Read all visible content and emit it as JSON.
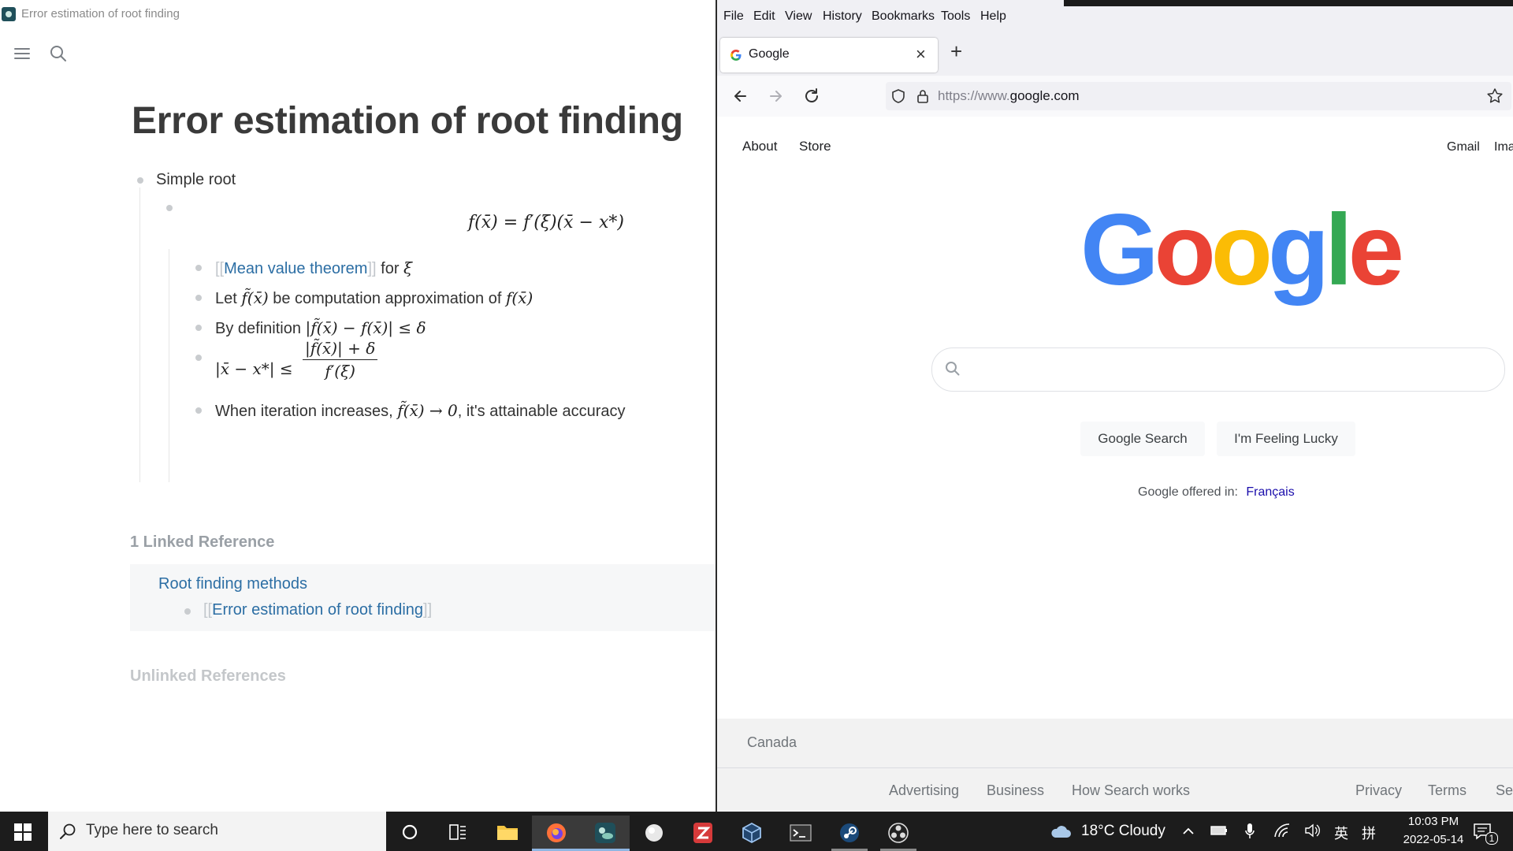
{
  "logseq": {
    "window_title": "Error estimation of root finding",
    "page_title": "Error estimation of root finding",
    "blocks": {
      "simple_root": "Simple root",
      "formula_main": "f(x̄) = f′(ξ)(x̄ − x*)",
      "mvt_open": "[[",
      "mvt_link": "Mean value theorem",
      "mvt_close": "]]",
      "mvt_rest": " for ",
      "mvt_xi": "ξ",
      "let_pre": "Let ",
      "let_math1": "f̃(x̄)",
      "let_mid": " be computation approximation of ",
      "let_math2": "f(x̄)",
      "bydef_pre": "By definition ",
      "bydef_math": "|f̃(x̄) − f(x̄)| ≤ δ",
      "ineq_lhs": "|x̄ − x*| ≤",
      "ineq_num": "|f̃(x̄)| + δ",
      "ineq_den": "f′(ξ)",
      "when_pre": "When iteration increases, ",
      "when_math": "f̃(x̄) → 0",
      "when_post": ", it's attainable accuracy"
    },
    "linked_refs_header": "1 Linked Reference",
    "linked_ref_page": "Root finding methods",
    "linked_ref_open": "[[",
    "linked_ref_block": "Error estimation of root finding",
    "linked_ref_close": "]]",
    "unlinked_refs_header": "Unlinked References"
  },
  "firefox": {
    "menu": [
      "File",
      "Edit",
      "View",
      "History",
      "Bookmarks",
      "Tools",
      "Help"
    ],
    "tab_title": "Google",
    "tab_close": "×",
    "new_tab": "+",
    "url_prefix": "https://www.",
    "url_domain": "google.com"
  },
  "google": {
    "top_left_links": [
      "About",
      "Store"
    ],
    "top_right_links": [
      "Gmail",
      "Ima"
    ],
    "logo_letters": [
      "G",
      "o",
      "o",
      "g",
      "l",
      "e"
    ],
    "logo_colors": [
      "#4285F4",
      "#EA4335",
      "#FBBC05",
      "#4285F4",
      "#34A853",
      "#EA4335"
    ],
    "search_button": "Google Search",
    "lucky_button": "I'm Feeling Lucky",
    "offered_in": "Google offered in:",
    "offered_lang": "Français",
    "country": "Canada",
    "footer_left": [
      "Advertising",
      "Business",
      "How Search works"
    ],
    "footer_right": [
      "Privacy",
      "Terms",
      "Se"
    ]
  },
  "taskbar": {
    "search_placeholder": "Type here to search",
    "weather": "18°C  Cloudy",
    "ime": "英",
    "ime2": "拼",
    "time": "10:03 PM",
    "date": "2022-05-14",
    "notif_count": "1"
  }
}
